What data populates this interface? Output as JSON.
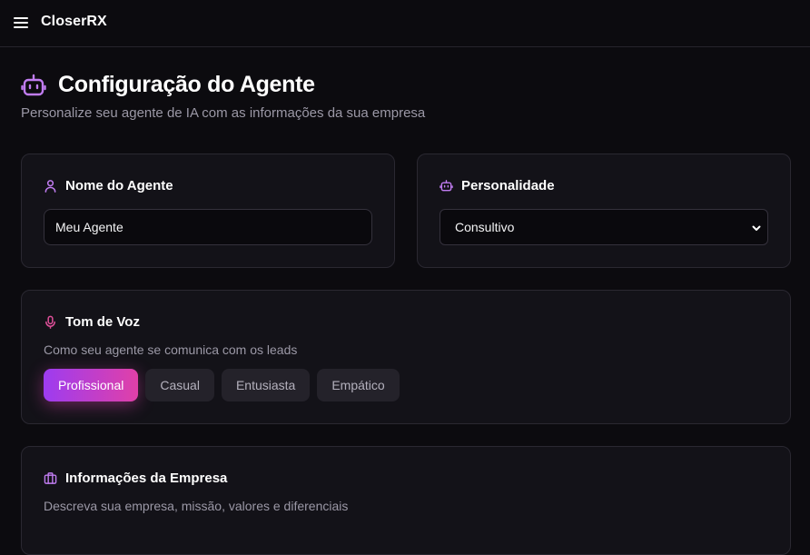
{
  "app": {
    "brand": "CloserRX"
  },
  "header": {
    "title": "Configuração do Agente",
    "subtitle": "Personalize seu agente de IA com as informações da sua empresa"
  },
  "agent_name": {
    "title": "Nome do Agente",
    "value": "Meu Agente"
  },
  "personality": {
    "title": "Personalidade",
    "selected": "Consultivo"
  },
  "voice": {
    "title": "Tom de Voz",
    "description": "Como seu agente se comunica com os leads",
    "options": [
      "Profissional",
      "Casual",
      "Entusiasta",
      "Empático"
    ],
    "selected": "Profissional"
  },
  "company": {
    "title": "Informações da Empresa",
    "description": "Descreva sua empresa, missão, valores e diferenciais"
  },
  "colors": {
    "background": "#0c0b0f",
    "card": "#131218",
    "accent_purple": "#b06cf0",
    "accent_pink": "#e0509a",
    "active_gradient_start": "#9d3cf0",
    "active_gradient_end": "#e040a8"
  },
  "icons": {
    "menu": "hamburger-menu-icon",
    "header": "robot-icon",
    "agent_name": "user-icon",
    "personality": "robot-icon",
    "voice": "microphone-icon",
    "company": "briefcase-icon",
    "select": "chevron-down-icon"
  }
}
